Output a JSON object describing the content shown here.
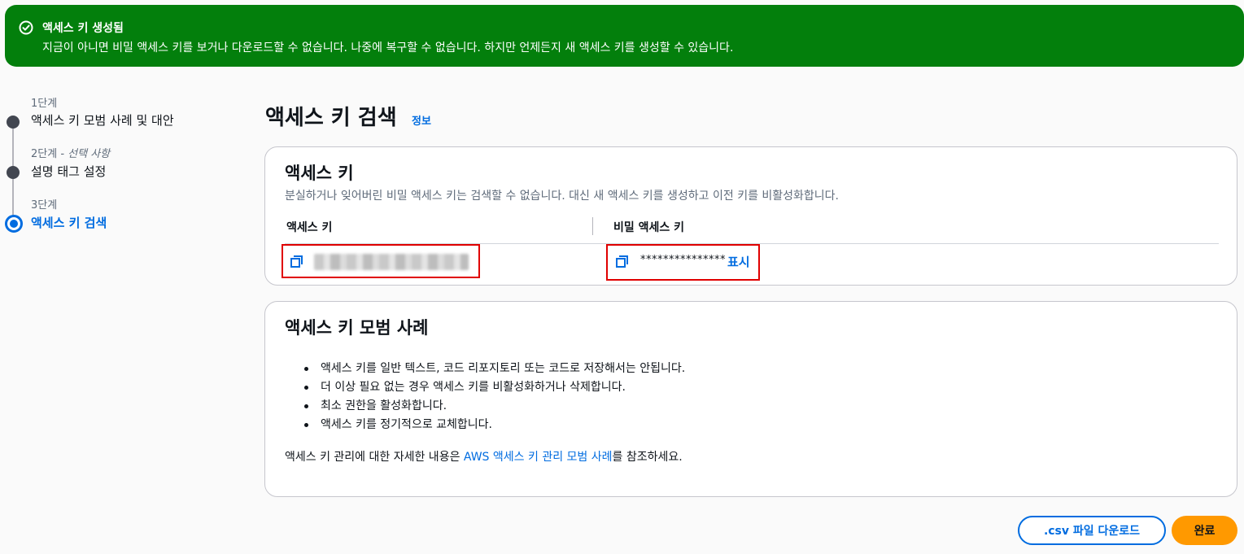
{
  "flash": {
    "title": "액세스 키 생성됨",
    "message": "지금이 아니면 비밀 액세스 키를 보거나 다운로드할 수 없습니다. 나중에 복구할 수 없습니다. 하지만 언제든지 새 액세스 키를 생성할 수 있습니다."
  },
  "steps": [
    {
      "number": "1단계",
      "name": "액세스 키 모범 사례 및 대안"
    },
    {
      "number": "2단계",
      "optional": "- 선택 사항",
      "name": "설명 태그 설정"
    },
    {
      "number": "3단계",
      "name": "액세스 키 검색"
    }
  ],
  "main": {
    "title": "액세스 키 검색",
    "info_link": "정보"
  },
  "access_key_panel": {
    "title": "액세스 키",
    "description": "분실하거나 잊어버린 비밀 액세스 키는 검색할 수 없습니다. 대신 새 액세스 키를 생성하고 이전 키를 비활성화합니다.",
    "col_access_key": "액세스 키",
    "col_secret_key": "비밀 액세스 키",
    "secret_masked": "***************",
    "show_label": "표시"
  },
  "best_practices": {
    "title": "액세스 키 모범 사례",
    "items": [
      "액세스 키를 일반 텍스트, 코드 리포지토리 또는 코드로 저장해서는 안됩니다.",
      "더 이상 필요 없는 경우 액세스 키를 비활성화하거나 삭제합니다.",
      "최소 권한을 활성화합니다.",
      "액세스 키를 정기적으로 교체합니다."
    ],
    "footnote_before": "액세스 키 관리에 대한 자세한 내용은 ",
    "footnote_link": "AWS 액세스 키 관리 모범 사례",
    "footnote_after": "를 참조하세요."
  },
  "buttons": {
    "csv": ".csv 파일 다운로드",
    "done": "완료"
  },
  "colors": {
    "success": "#037f0c",
    "link": "#006ce0",
    "primary": "#ff9900",
    "highlight": "#e00000"
  },
  "icons": {
    "flash": "check-circle-icon",
    "copy": "copy-icon"
  }
}
